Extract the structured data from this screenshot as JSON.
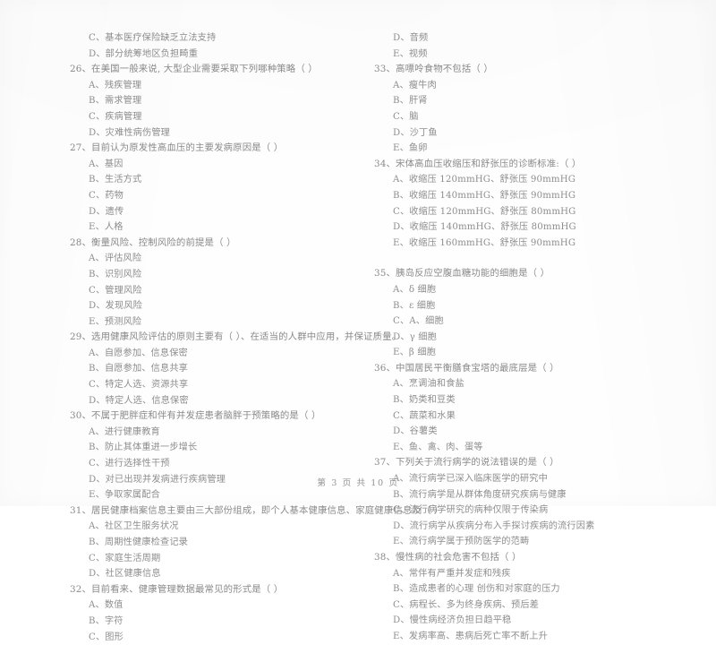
{
  "document": {
    "type": "exam-paper",
    "footer": "第 3 页 共 10 页"
  },
  "columns": [
    {
      "id": "left",
      "blocks": [
        {
          "kind": "option",
          "text": "C、基本医疗保险缺乏立法支持"
        },
        {
          "kind": "option",
          "text": "D、部分统筹地区负担畸重"
        },
        {
          "kind": "stem",
          "text": "26、在美国一般来说, 大型企业需要采取下列哪种策略（    ）"
        },
        {
          "kind": "option",
          "text": "A、残疾管理"
        },
        {
          "kind": "option",
          "text": "B、需求管理"
        },
        {
          "kind": "option",
          "text": "C、疾病管理"
        },
        {
          "kind": "option",
          "text": "D、灾难性病伤管理"
        },
        {
          "kind": "stem",
          "text": "27、目前认为原发性高血压的主要发病原因是（    ）"
        },
        {
          "kind": "option",
          "text": "A、基因"
        },
        {
          "kind": "option",
          "text": "B、生活方式"
        },
        {
          "kind": "option",
          "text": "C、药物"
        },
        {
          "kind": "option",
          "text": "D、遗传"
        },
        {
          "kind": "option",
          "text": "E、人格"
        },
        {
          "kind": "stem",
          "text": "28、衡量风险、控制风险的前提是（    ）"
        },
        {
          "kind": "option",
          "text": "A、评估风险"
        },
        {
          "kind": "option",
          "text": "B、识别风险"
        },
        {
          "kind": "option",
          "text": "C、管理风险"
        },
        {
          "kind": "option",
          "text": "D、发现风险"
        },
        {
          "kind": "option",
          "text": "E、预测风险"
        },
        {
          "kind": "stem",
          "text": "29、选用健康风险评估的原则主要有（    ）、在适当的人群中应用，并保证质量。"
        },
        {
          "kind": "option",
          "text": "A、自愿参加、信息保密"
        },
        {
          "kind": "option",
          "text": "B、自愿参加、信息共享"
        },
        {
          "kind": "option",
          "text": "C、特定人选、资源共享"
        },
        {
          "kind": "option",
          "text": "D、特定人选、信息保密"
        },
        {
          "kind": "stem",
          "text": "30、不属于肥胖症和伴有并发症患者脑胖于预策略的是（    ）"
        },
        {
          "kind": "option",
          "text": "A、进行健康教育"
        },
        {
          "kind": "option",
          "text": "B、防止其体重进一步增长"
        },
        {
          "kind": "option",
          "text": "C、进行选择性干预"
        },
        {
          "kind": "option",
          "text": "D、对已出现并发病进行疾病管理"
        },
        {
          "kind": "option",
          "text": "E、争取家属配合"
        },
        {
          "kind": "stem",
          "text": "31、居民健康档案信息主要由三大部份组成，即个人基本健康信息、家庭健康信息及（    ）"
        },
        {
          "kind": "option",
          "text": "A、社区卫生服务状况"
        },
        {
          "kind": "option",
          "text": "B、周期性健康检查记录"
        },
        {
          "kind": "option",
          "text": "C、家庭生活周期"
        },
        {
          "kind": "option",
          "text": "D、社区健康信息"
        },
        {
          "kind": "stem",
          "text": "32、目前看来、健康管理数据最常见的形式是（    ）"
        },
        {
          "kind": "option",
          "text": "A、数值"
        },
        {
          "kind": "option",
          "text": "B、字符"
        },
        {
          "kind": "option",
          "text": "C、图形"
        }
      ]
    },
    {
      "id": "right",
      "blocks": [
        {
          "kind": "option",
          "text": "D、音频"
        },
        {
          "kind": "option",
          "text": "E、视频"
        },
        {
          "kind": "stem",
          "text": "33、高嘌呤食物不包括（    ）"
        },
        {
          "kind": "option",
          "text": "A、瘦牛肉"
        },
        {
          "kind": "option",
          "text": "B、肝肾"
        },
        {
          "kind": "option",
          "text": "C、脑"
        },
        {
          "kind": "option",
          "text": "D、沙丁鱼"
        },
        {
          "kind": "option",
          "text": "E、鱼卵"
        },
        {
          "kind": "stem",
          "text": "34、宋体高血压收缩压和舒张压的诊断标准:（    ）"
        },
        {
          "kind": "option",
          "text": "A、收缩压 120mmHG、舒张压 90mmHG"
        },
        {
          "kind": "option",
          "text": "B、收缩压 140mmHG、舒张压 90mmHG"
        },
        {
          "kind": "option",
          "text": "C、收缩压 120mmHG、舒张压 80mmHG"
        },
        {
          "kind": "option",
          "text": "D、收缩压 140mmHG、舒张压 80mmHG"
        },
        {
          "kind": "option",
          "text": "E、收缩压 160mmHG、舒张压 90mmHG"
        },
        {
          "kind": "gap"
        },
        {
          "kind": "stem",
          "text": "35、胰岛反应空腹血糖功能的细胞是（    ）"
        },
        {
          "kind": "option",
          "text": "A、δ 细胞"
        },
        {
          "kind": "option",
          "text": "B、ε 细胞"
        },
        {
          "kind": "option",
          "text": "C、A、细胞"
        },
        {
          "kind": "option",
          "text": "D、γ 细胞"
        },
        {
          "kind": "option",
          "text": "E、β 细胞"
        },
        {
          "kind": "stem",
          "text": "36、中国居民平衡膳食宝塔的最底层是（    ）"
        },
        {
          "kind": "option",
          "text": "A、烹调油和食盐"
        },
        {
          "kind": "option",
          "text": "B、奶类和豆类"
        },
        {
          "kind": "option",
          "text": "C、蔬菜和水果"
        },
        {
          "kind": "option",
          "text": "D、谷薯类"
        },
        {
          "kind": "option",
          "text": "E、鱼、禽、肉、蛋等"
        },
        {
          "kind": "stem",
          "text": "37、下列关于流行病学的说法错误的是（    ）"
        },
        {
          "kind": "option",
          "text": "A、流行病学已深入临床医学的研究中"
        },
        {
          "kind": "option",
          "text": "B、流行病学是从群体角度研究疾病与健康"
        },
        {
          "kind": "option",
          "text": "C、流行病学研究的病种仅限于传染病"
        },
        {
          "kind": "option",
          "text": "D、流行病学从疾病分布入手探讨疾病的流行因素"
        },
        {
          "kind": "option",
          "text": "E、流行病学属于预防医学的范畴"
        },
        {
          "kind": "stem",
          "text": "38、慢性病的社会危害不包括（    ）"
        },
        {
          "kind": "option",
          "text": "A、常伴有严重并发症和残疾"
        },
        {
          "kind": "option",
          "text": "B、造成患者的心理  创伤和对家庭的压力"
        },
        {
          "kind": "option",
          "text": "C、病程长、多为终身疾病、预后差"
        },
        {
          "kind": "option",
          "text": "D、慢性病经济负担日趋平稳"
        },
        {
          "kind": "option",
          "text": "E、发病率高、患病后死亡率不断上升"
        }
      ]
    }
  ]
}
